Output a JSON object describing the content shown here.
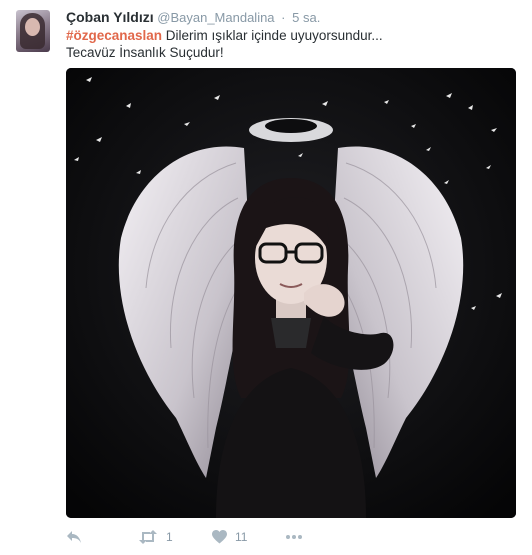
{
  "tweet": {
    "name": "Çoban Yıldızı",
    "handle": "@Bayan_Mandalina",
    "separator": "·",
    "time": "5 sa.",
    "hashtag": "#özgecanaslan",
    "line1_rest": " Dilerim ışıklar içinde uyuyorsundur...",
    "line2": "Tecavüz İnsanlık Suçudur!"
  },
  "actions": {
    "retweet_count": "1",
    "like_count": "11"
  },
  "colors": {
    "hashtag": "#e1684b",
    "name": "#292f33",
    "meta": "#8899a6",
    "icon": "#aab8c2"
  },
  "icons": [
    "reply-icon",
    "retweet-icon",
    "like-icon",
    "more-icon"
  ]
}
